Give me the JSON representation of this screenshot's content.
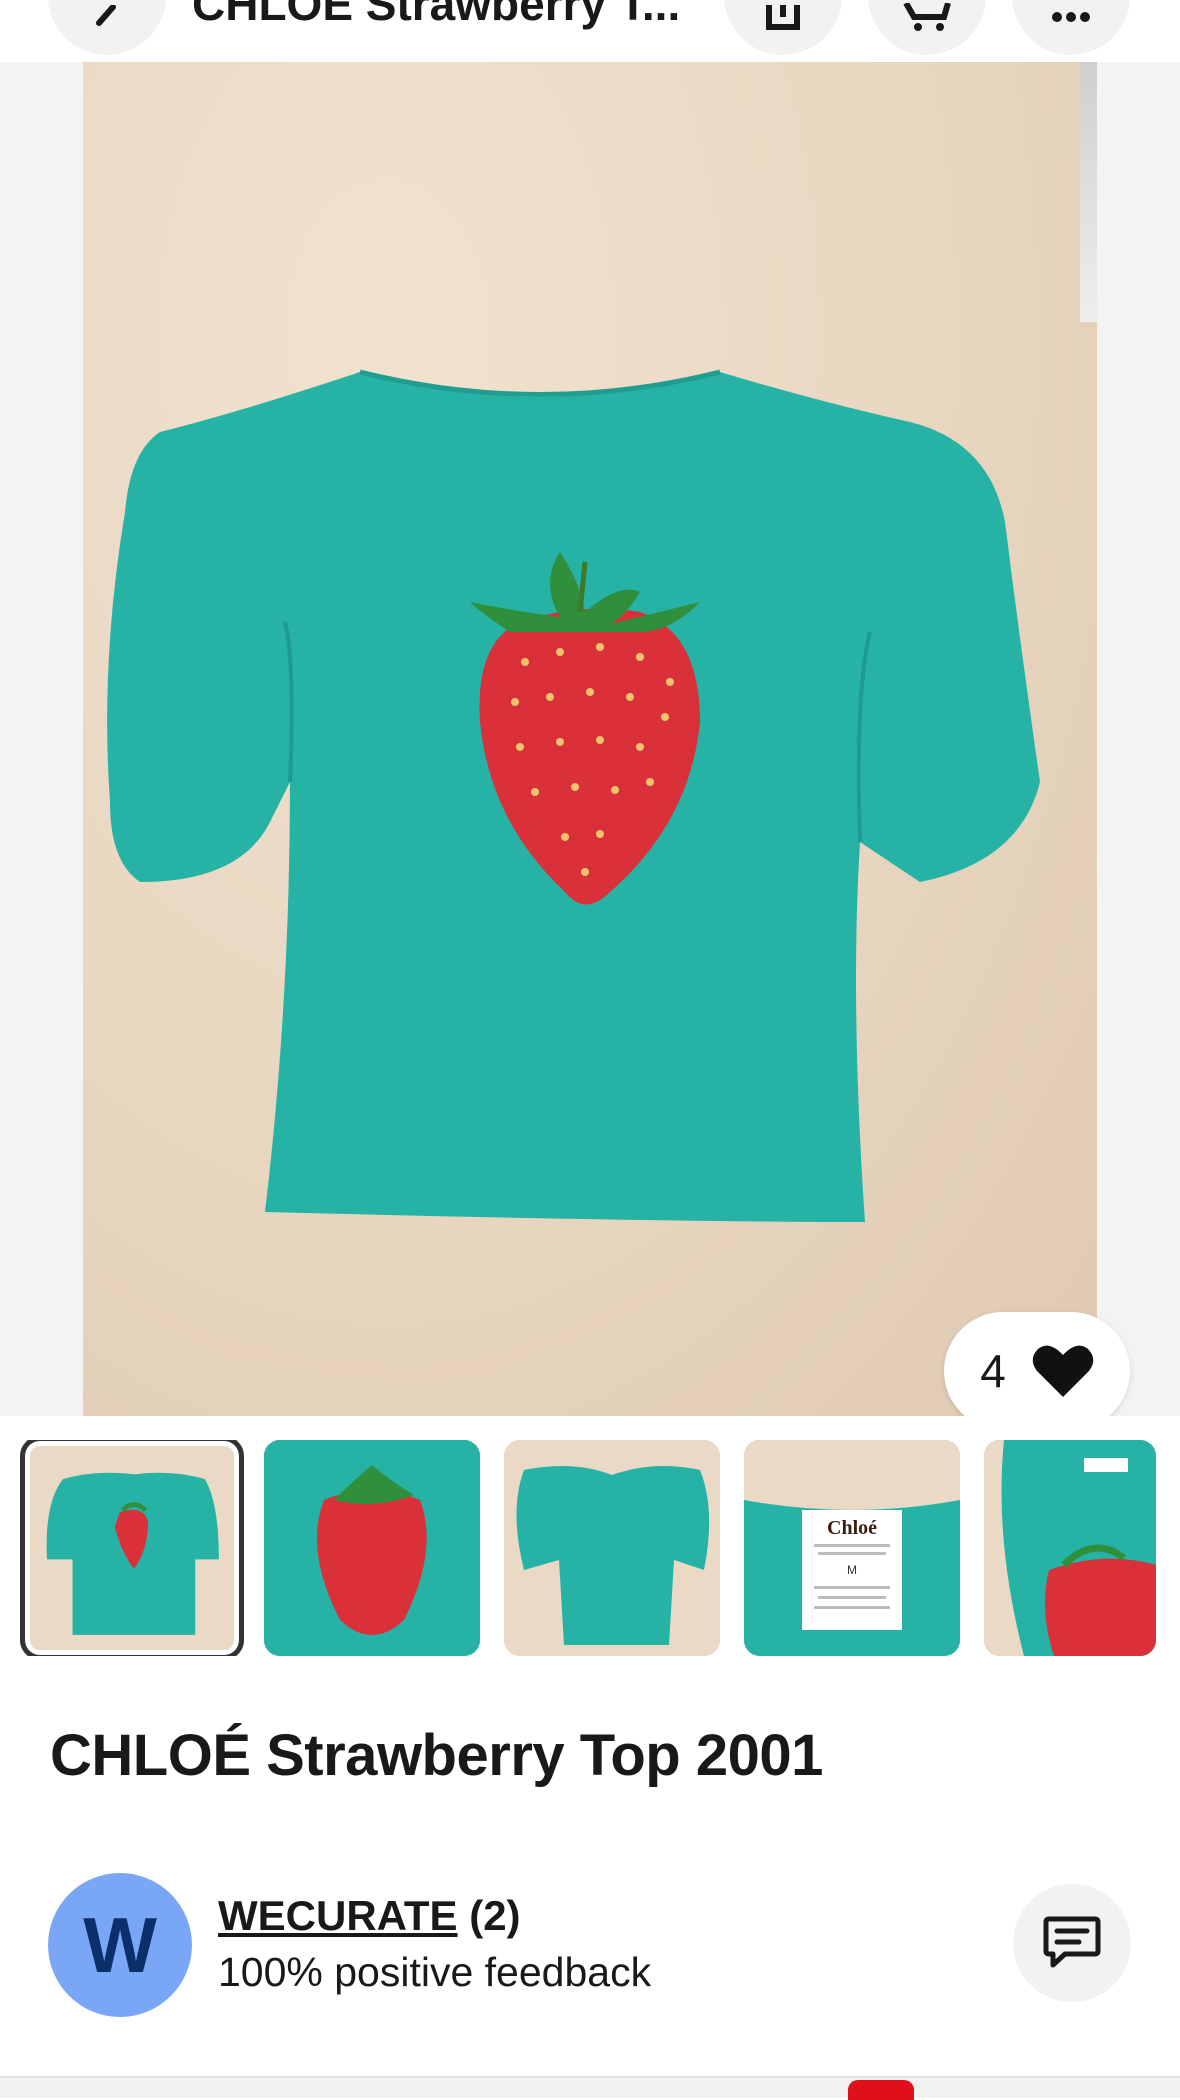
{
  "header": {
    "title": "CHLOÉ Strawberry T...",
    "back_icon": "chevron-left-icon",
    "share_icon": "share-icon",
    "cart_icon": "cart-icon",
    "more_icon": "more-icon"
  },
  "gallery": {
    "favorite_count": "4",
    "thumbnails": [
      {
        "label": "Front view with strawberry print"
      },
      {
        "label": "Close-up of strawberry print"
      },
      {
        "label": "Back view"
      },
      {
        "label": "Care label"
      },
      {
        "label": "Neck label and print"
      }
    ],
    "label_text": "Chloé",
    "label_size": "M"
  },
  "item": {
    "title": "CHLOÉ Strawberry Top 2001"
  },
  "seller": {
    "avatar_letter": "W",
    "name": "WECURATE",
    "count": "(2)",
    "feedback": "100% positive feedback"
  },
  "colors": {
    "shirt": "#26b3a6",
    "strawberry": "#d9303a",
    "background_paper": "#ead9c4",
    "avatar": "#7aa7f5"
  }
}
